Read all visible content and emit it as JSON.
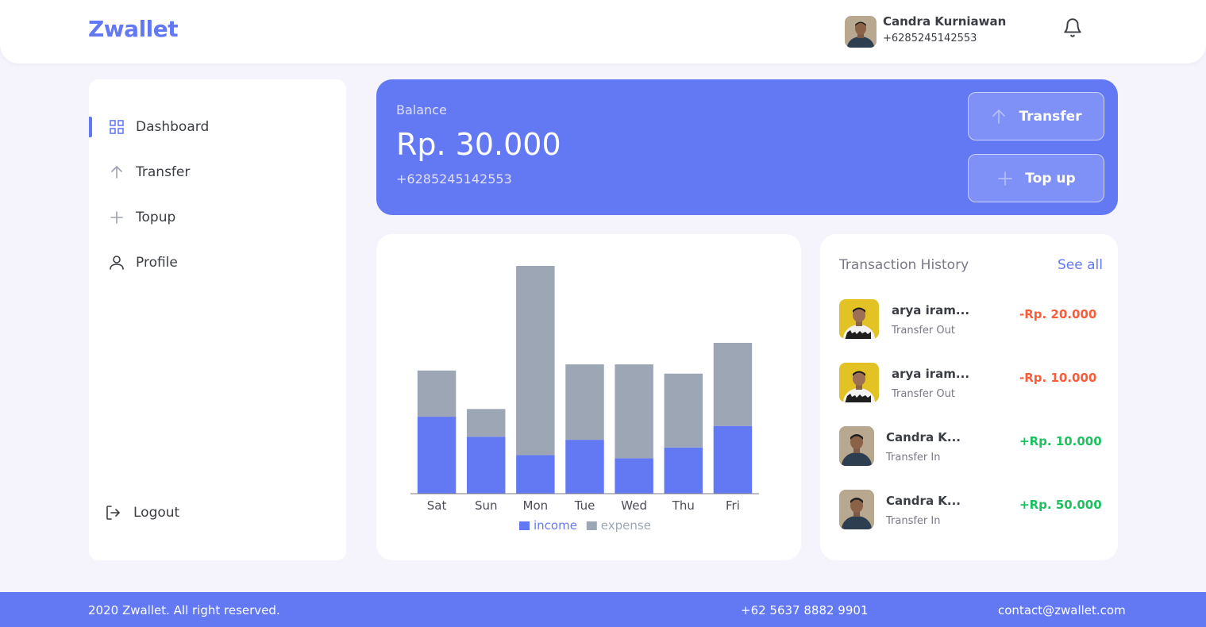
{
  "header": {
    "brand": "Zwallet",
    "user_name": "Candra Kurniawan",
    "user_phone": "+6285245142553"
  },
  "sidebar": {
    "items": [
      {
        "label": "Dashboard",
        "icon": "grid-icon",
        "active": true
      },
      {
        "label": "Transfer",
        "icon": "arrow-up-icon",
        "active": false
      },
      {
        "label": "Topup",
        "icon": "plus-icon",
        "active": false
      },
      {
        "label": "Profile",
        "icon": "user-icon",
        "active": false
      }
    ],
    "logout_label": "Logout"
  },
  "balance": {
    "label": "Balance",
    "amount": "Rp. 30.000",
    "phone": "+6285245142553",
    "transfer_label": "Transfer",
    "topup_label": "Top up"
  },
  "chart_data": {
    "type": "bar",
    "stacked": true,
    "categories": [
      "Sat",
      "Sun",
      "Mon",
      "Tue",
      "Wed",
      "Thu",
      "Fri"
    ],
    "series": [
      {
        "name": "income",
        "color": "#6379f4",
        "values": [
          50,
          37,
          25,
          35,
          23,
          30,
          44
        ]
      },
      {
        "name": "expense",
        "color": "#9da6b5",
        "values": [
          30,
          18,
          123,
          49,
          61,
          48,
          54
        ]
      }
    ],
    "ylim": [
      0,
      148
    ],
    "legend_position": "bottom",
    "grid": false
  },
  "transactions": {
    "title": "Transaction History",
    "see_all": "See all",
    "items": [
      {
        "name": "arya iram...",
        "type": "Transfer Out",
        "amount": "-Rp. 20.000",
        "color": "#ff5b37",
        "avatar_bg": "#e2c225"
      },
      {
        "name": "arya iram...",
        "type": "Transfer Out",
        "amount": "-Rp. 10.000",
        "color": "#ff5b37",
        "avatar_bg": "#e2c225"
      },
      {
        "name": "Candra K...",
        "type": "Transfer In",
        "amount": "+Rp. 10.000",
        "color": "#1ec15f",
        "avatar_bg": "#b9a890"
      },
      {
        "name": "Candra K...",
        "type": "Transfer In",
        "amount": "+Rp. 50.000",
        "color": "#1ec15f",
        "avatar_bg": "#b9a890"
      }
    ]
  },
  "footer": {
    "copyright": "2020 Zwallet. All right reserved.",
    "phone": "+62 5637 8882 9901",
    "email": "contact@zwallet.com"
  }
}
